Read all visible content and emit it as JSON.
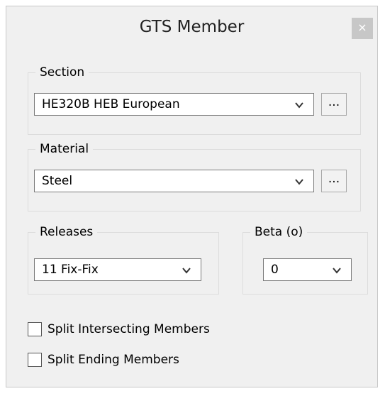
{
  "window": {
    "title": "GTS Member",
    "close_label": "×"
  },
  "section": {
    "legend": "Section",
    "value": "HE320B HEB European",
    "browse_label": "..."
  },
  "material": {
    "legend": "Material",
    "value": "Steel",
    "browse_label": "..."
  },
  "releases": {
    "legend": "Releases",
    "value": "11 Fix-Fix"
  },
  "beta": {
    "legend": "Beta (o)",
    "value": "0"
  },
  "options": {
    "split_intersecting": {
      "label": "Split Intersecting Members",
      "checked": false
    },
    "split_ending": {
      "label": "Split Ending Members",
      "checked": false
    }
  },
  "icons": {
    "dropdown": "chevron-down-icon",
    "close": "close-icon"
  }
}
